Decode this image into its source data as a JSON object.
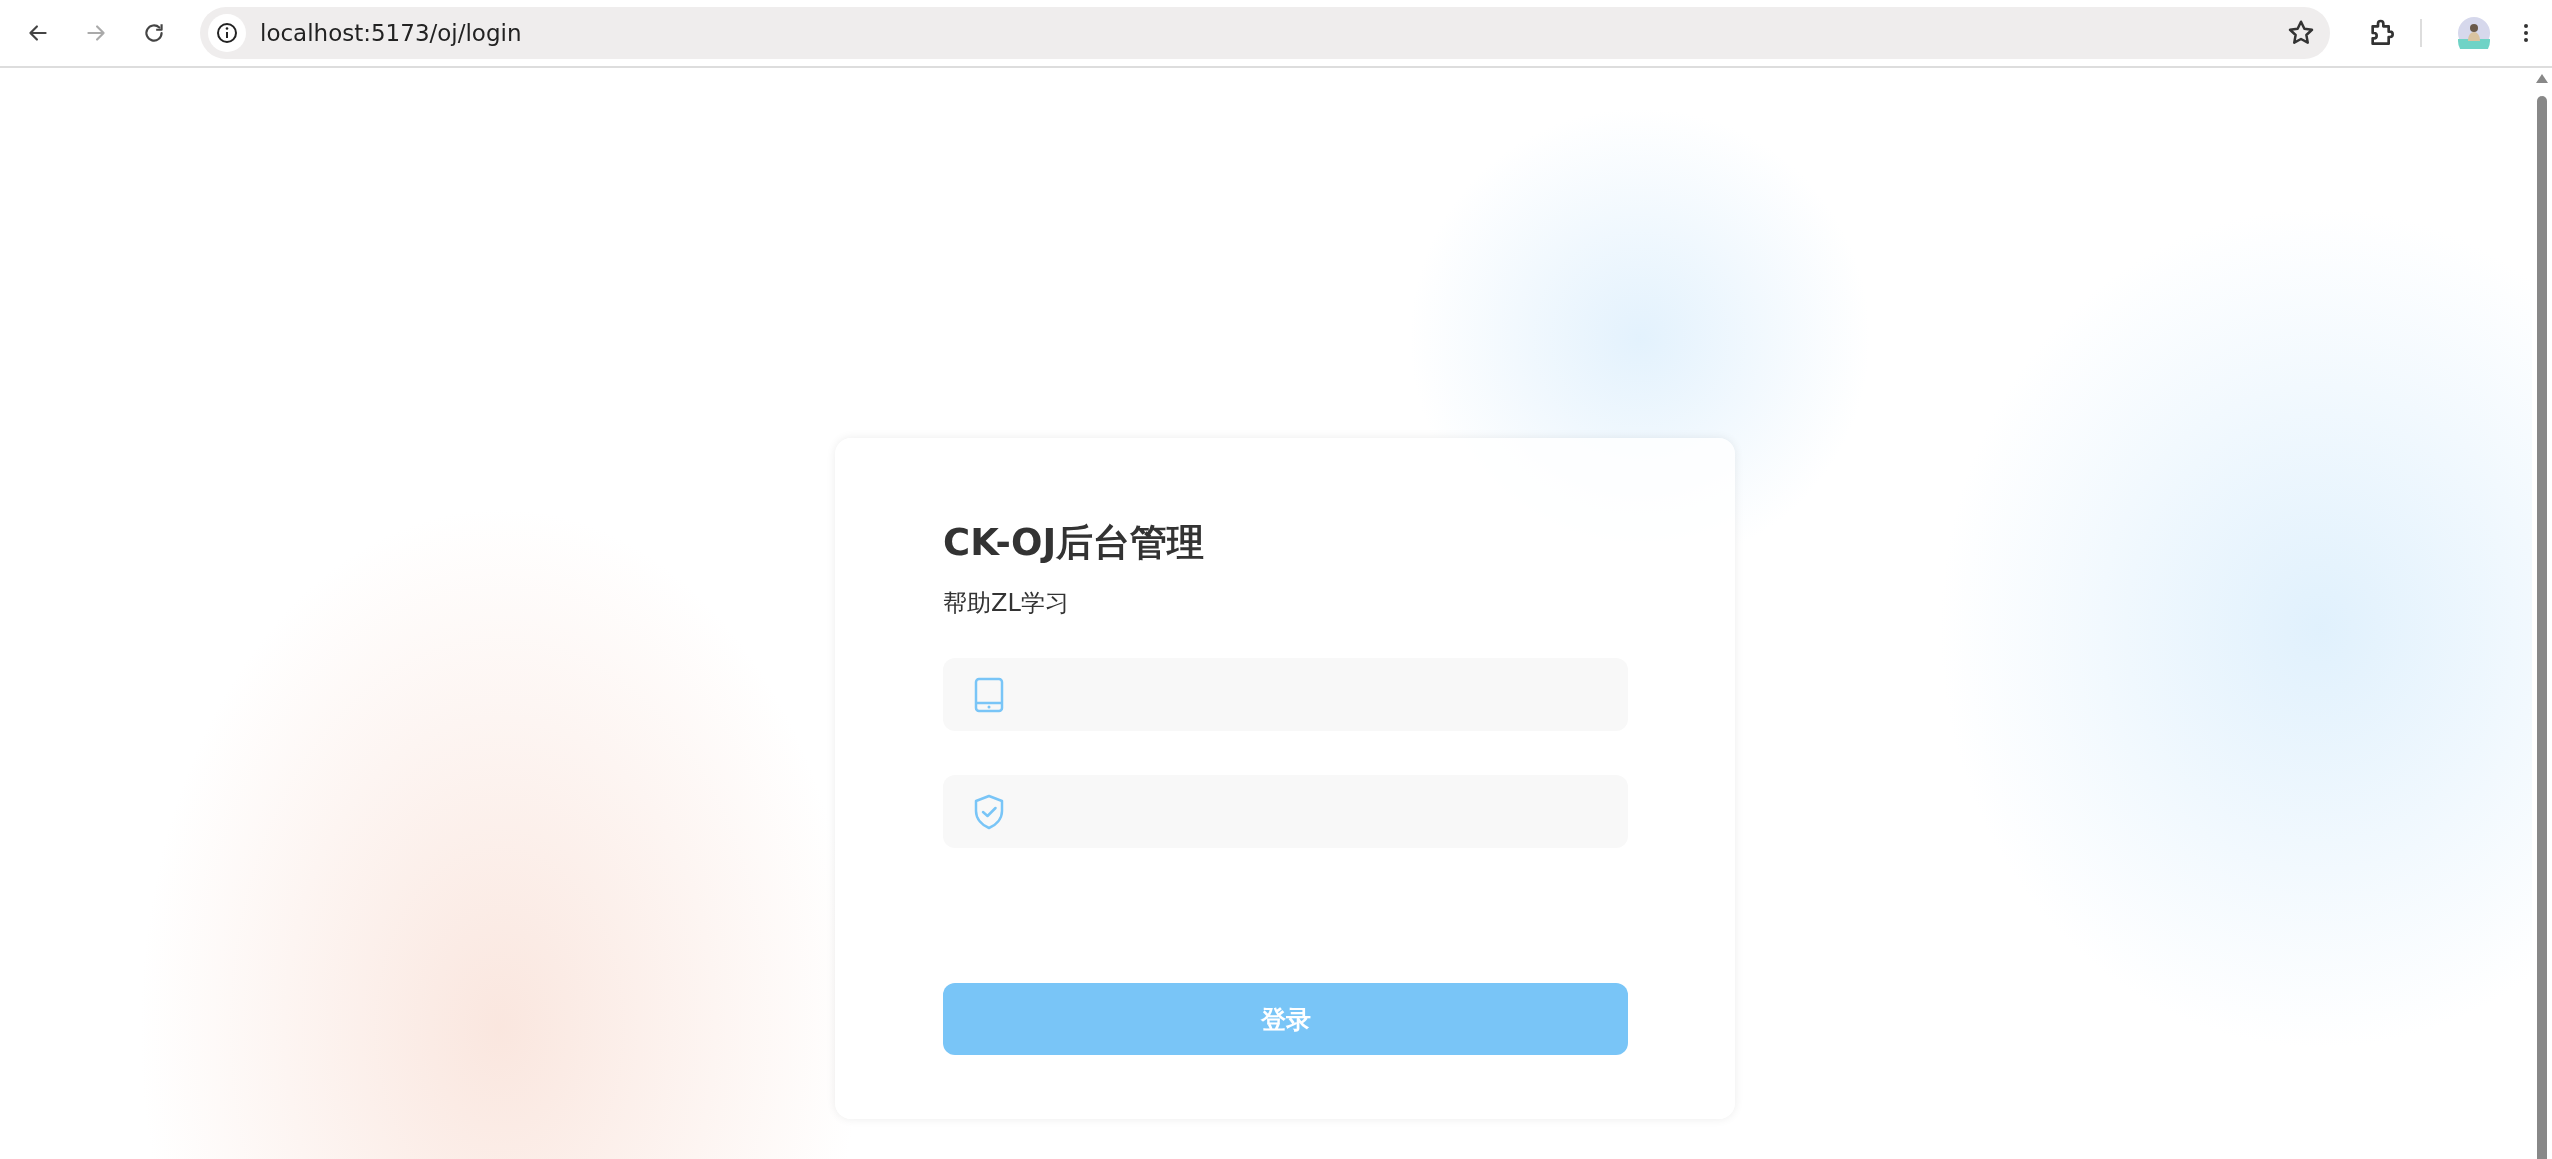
{
  "browser": {
    "nav_buttons": [
      {
        "kind": "back",
        "disabled": false
      },
      {
        "kind": "forward",
        "disabled": true
      },
      {
        "kind": "reload",
        "disabled": false
      }
    ],
    "url": "localhost:5173/oj/login"
  },
  "login": {
    "title": "CK-OJ后台管理",
    "subtitle": "帮助ZL学习",
    "fields": [
      {
        "kind": "account"
      },
      {
        "kind": "password"
      }
    ],
    "button": "登录"
  }
}
